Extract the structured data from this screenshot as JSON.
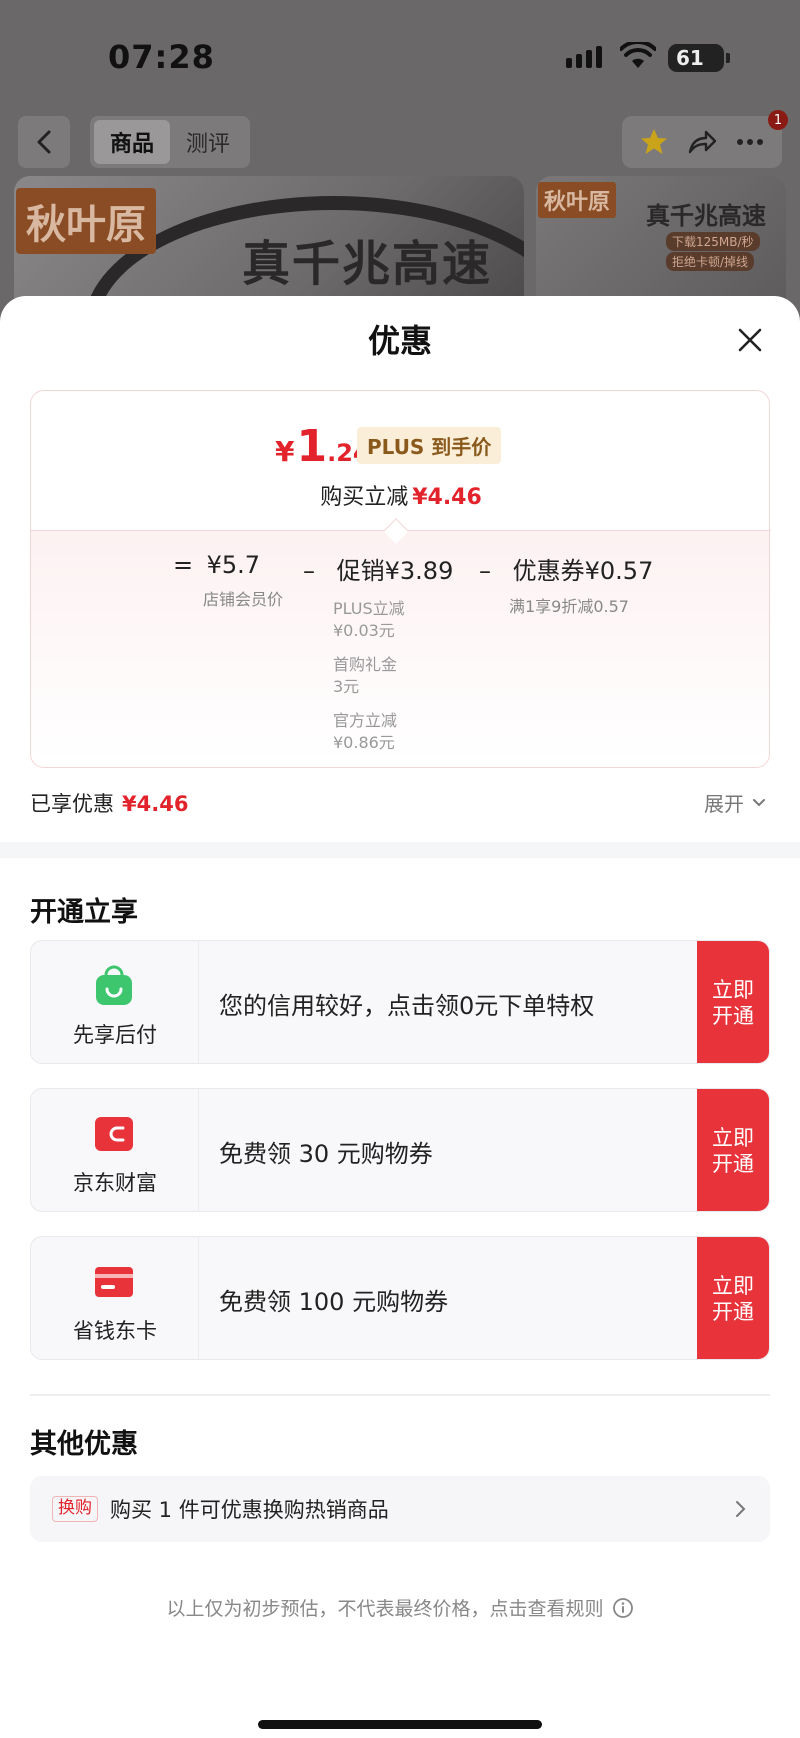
{
  "status_bar": {
    "time": "07:28",
    "battery": "61"
  },
  "nav": {
    "tabs": [
      {
        "label": "商品"
      },
      {
        "label": "测评"
      }
    ],
    "cart_badge": "1"
  },
  "hero": {
    "brand": "秋叶原",
    "slogan": "真千兆高速",
    "side_brand": "秋叶原",
    "side_slogan": "真千兆高速",
    "side_features": [
      "下载125MB/秒",
      "拒绝卡顿/掉线"
    ]
  },
  "sheet": {
    "title": "优惠",
    "final_price": {
      "symbol": "¥",
      "integer": "1",
      "decimal": ".24"
    },
    "plus_tag": "PLUS 到手价",
    "instant_cut_label": "购买立减",
    "instant_cut_value": "¥4.46",
    "breakdown": {
      "base": {
        "op": "=",
        "value": "¥5.7",
        "sub": "店铺会员价"
      },
      "promo": {
        "op": "–",
        "value": "促销¥3.89",
        "items": [
          {
            "label": "PLUS立减",
            "value": "¥0.03元"
          },
          {
            "label": "首购礼金",
            "value": "3元"
          },
          {
            "label": "官方立减",
            "value": "¥0.86元"
          }
        ]
      },
      "coupon": {
        "op": "–",
        "value": "优惠券¥0.57",
        "sub": "满1享9折减0.57"
      }
    },
    "enjoyed_label": "已享优惠",
    "enjoyed_value": "¥4.46",
    "expand_label": "展开",
    "open_section_title": "开通立享",
    "open_cards": [
      {
        "name": "先享后付",
        "icon": "bag-icon",
        "icon_color": "#3ec66f",
        "text": "您的信用较好，点击领0元下单特权",
        "button": [
          "立即",
          "开通"
        ]
      },
      {
        "name": "京东财富",
        "icon": "wallet-icon",
        "icon_color": "#e8333a",
        "text": "免费领 30 元购物券",
        "button": [
          "立即",
          "开通"
        ]
      },
      {
        "name": "省钱东卡",
        "icon": "card-icon",
        "icon_color": "#e8333a",
        "text": "免费领 100 元购物券",
        "button": [
          "立即",
          "开通"
        ]
      }
    ],
    "other_section_title": "其他优惠",
    "other_row": {
      "tag": "换购",
      "text": "购买 1 件可优惠换购热销商品"
    },
    "disclaimer": "以上仅为初步预估，不代表最终价格，点击查看规则"
  },
  "colors": {
    "accent_red": "#e3232b",
    "button_red": "#e8333a",
    "plus_gold": "#8a5a1c"
  }
}
